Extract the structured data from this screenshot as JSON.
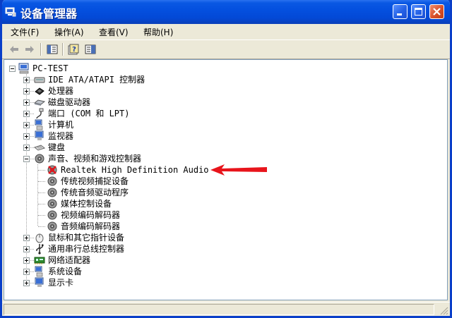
{
  "window": {
    "title": "设备管理器",
    "buttons": {
      "minimize": "minimize",
      "maximize": "maximize",
      "close": "close"
    }
  },
  "menu": [
    {
      "label": "文件(F)"
    },
    {
      "label": "操作(A)"
    },
    {
      "label": "查看(V)"
    },
    {
      "label": "帮助(H)"
    }
  ],
  "toolbar": {
    "icons": [
      "back-arrow-icon",
      "forward-arrow-icon",
      "properties-icon",
      "help-icon",
      "view-icon"
    ]
  },
  "tree": {
    "root": "PC-TEST",
    "categories": [
      {
        "label": "IDE ATA/ATAPI 控制器",
        "icon": "ide-controller-icon",
        "expanded": false
      },
      {
        "label": "处理器",
        "icon": "processor-icon",
        "expanded": false
      },
      {
        "label": "磁盘驱动器",
        "icon": "disk-drive-icon",
        "expanded": false
      },
      {
        "label": "端口 (COM 和 LPT)",
        "icon": "port-icon",
        "expanded": false
      },
      {
        "label": "计算机",
        "icon": "computer-icon",
        "expanded": false
      },
      {
        "label": "监视器",
        "icon": "monitor-icon",
        "expanded": false
      },
      {
        "label": "键盘",
        "icon": "keyboard-icon",
        "expanded": false
      },
      {
        "label": "声音、视频和游戏控制器",
        "icon": "sound-icon",
        "expanded": true,
        "children": [
          {
            "label": "Realtek High Definition Audio",
            "icon": "device-error-icon",
            "error": true
          },
          {
            "label": "传统视频捕捉设备",
            "icon": "speaker-icon"
          },
          {
            "label": "传统音频驱动程序",
            "icon": "speaker-icon"
          },
          {
            "label": "媒体控制设备",
            "icon": "speaker-icon"
          },
          {
            "label": "视频编码解码器",
            "icon": "speaker-icon"
          },
          {
            "label": "音频编码解码器",
            "icon": "speaker-icon"
          }
        ]
      },
      {
        "label": "鼠标和其它指针设备",
        "icon": "mouse-icon",
        "expanded": false
      },
      {
        "label": "通用串行总线控制器",
        "icon": "usb-icon",
        "expanded": false
      },
      {
        "label": "网络适配器",
        "icon": "network-adapter-icon",
        "expanded": false
      },
      {
        "label": "系统设备",
        "icon": "system-device-icon",
        "expanded": false
      },
      {
        "label": "显示卡",
        "icon": "display-adapter-icon",
        "expanded": false
      }
    ]
  },
  "annotation": {
    "arrow_color": "#e8141b",
    "points_to": "Realtek High Definition Audio"
  },
  "colors": {
    "titlebar": "#0450df",
    "chrome": "#ece9d8",
    "error": "#e8141b"
  }
}
